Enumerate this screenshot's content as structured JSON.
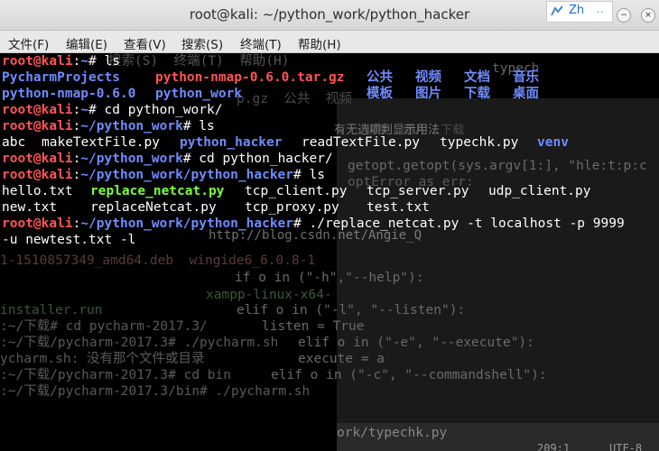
{
  "window": {
    "title": "root@kali: ~/python_work/python_hacker",
    "ime_label": "Zh",
    "ime_extra": "··",
    "min_label": "−",
    "max_label": "▫",
    "close_label": "×"
  },
  "menu": [
    "文件(F)",
    "编辑(E)",
    "查看(V)",
    "搜索(S)",
    "终端(T)",
    "帮助(H)"
  ],
  "terminal": {
    "prompt_user": "root@kali",
    "colon": ":",
    "lines": [
      {
        "path": "~",
        "sym": "# ",
        "cmd": "ls"
      },
      {
        "path": "~",
        "sym": "# ",
        "cmd": "cd python_work/"
      },
      {
        "path": "~/python_work",
        "sym": "# ",
        "cmd": "ls"
      },
      {
        "path": "~/python_work",
        "sym": "# ",
        "cmd": "cd python_hacker/"
      },
      {
        "path": "~/python_work/python_hacker",
        "sym": "# ",
        "cmd": "ls"
      },
      {
        "path": "~/python_work/python_hacker",
        "sym": "# ",
        "cmd": "./replace_netcat.py -t localhost -p 9999"
      }
    ],
    "ls1_row1": [
      "PycharmProjects",
      "python-nmap-0.6.0.tar.gz",
      "公共",
      "视频",
      "文档",
      "音乐"
    ],
    "ls1_row2": [
      "python-nmap-0.6.0",
      "python_work",
      "模板",
      "图片",
      "下载",
      "桌面"
    ],
    "ls2": [
      "abc",
      "makeTextFile.py",
      "python_hacker",
      "readTextFile.py",
      "typechk.py",
      "venv"
    ],
    "ls3_row1": [
      "hello.txt",
      "replace_netcat.py",
      "tcp_client.py",
      "tcp_server.py",
      "udp_client.py"
    ],
    "ls3_row2": [
      "new.txt",
      "replaceNetcat.py",
      "tcp_proxy.py",
      "test.txt"
    ],
    "continuation": "-u newtest.txt -l"
  },
  "ghost": {
    "l1": "搜索(S)  终端(T)  帮助(H)",
    "l2": "typech",
    "l3": "p.gz  公共  视频",
    "l4": "模板  图片  下载",
    "l5": "有无选项判显示用法",
    "l6": "getopt.getopt(sys.argv[1:], \"hle:t:p:c",
    "l7": "optError as err:",
    "l8": "1-1510857349_amd64.deb  wingide6_6.0.8-1",
    "l9": "if o in (\"-h\",\"--help\"):",
    "l10": "xampp-linux-x64-",
    "l11": "elif o in (\"-l\", \"--listen\"):",
    "l12": "installer.run",
    "l13": "listen = True",
    "l14": ":~/下载# cd pycharm-2017.3/",
    "l15": ":~/下载/pycharm-2017.3# ./pycharm.sh",
    "l16": "elif o in (\"-e\", \"--execute\"):",
    "l17": "ycharm.sh: 没有那个文件或目录",
    "l18": "execute = a",
    "l19": ":~/下载/pycharm-2017.3# cd bin",
    "l20": "elif o in (\"-c\", \"--commandshell\"):",
    "l21": ":~/下载/pycharm-2017.3/bin# ./pycharm.sh",
    "l22": "ork/typechk.py",
    "l23": "209:1",
    "l24": "UTF-8"
  },
  "watermark": "http://blog.csdn.net/Angie_Q"
}
